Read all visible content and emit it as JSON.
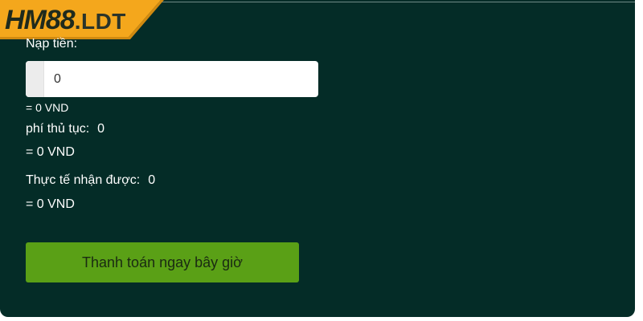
{
  "brand": {
    "logo_main": "HM88",
    "logo_suffix": ".LDT",
    "logo_color": "#f4a71c"
  },
  "form": {
    "deposit_label": "Nạp tiền:",
    "deposit_value": "0",
    "deposit_converted": "= 0 VND",
    "fee_label": "phí thủ tục:",
    "fee_value": "0",
    "fee_converted": "= 0 VND",
    "received_label": "Thực tế nhận được:",
    "received_value": "0",
    "received_converted": "= 0 VND"
  },
  "actions": {
    "pay_now_label": "Thanh toán ngay bây giờ"
  },
  "colors": {
    "panel_background": "#042c27",
    "button_background": "#5aa016",
    "text": "#ffffff"
  }
}
